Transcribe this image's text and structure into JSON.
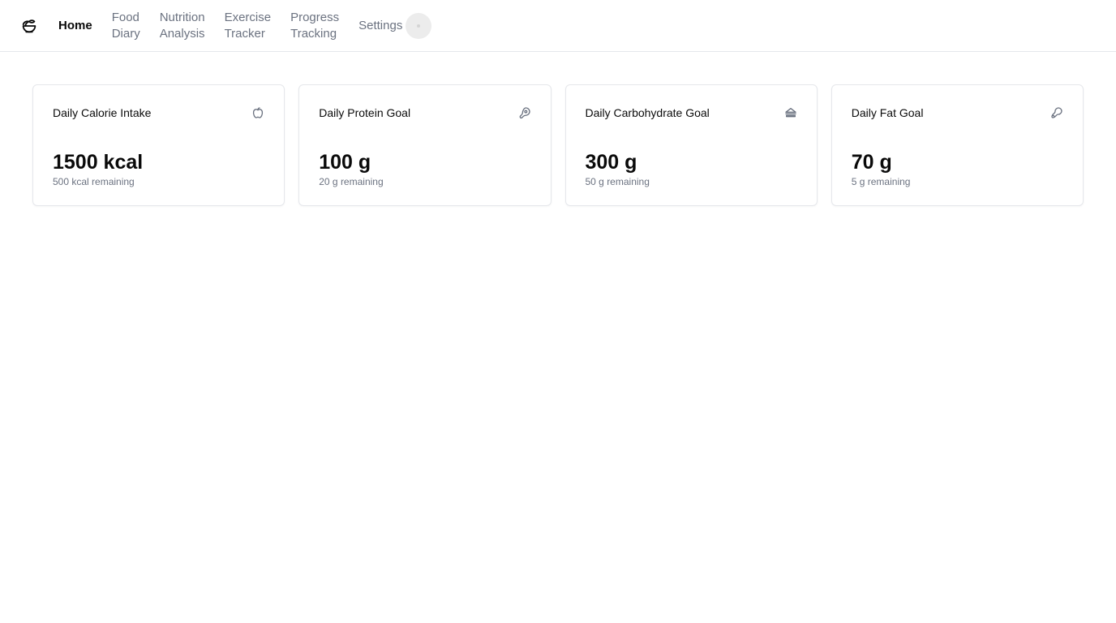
{
  "nav": {
    "items": [
      {
        "label": "Home"
      },
      {
        "label": "Food\nDiary"
      },
      {
        "label": "Nutrition\nAnalysis"
      },
      {
        "label": "Exercise\nTracker"
      },
      {
        "label": "Progress\nTracking"
      },
      {
        "label": "Settings"
      }
    ]
  },
  "cards": [
    {
      "title": "Daily Calorie Intake",
      "value": "1500 kcal",
      "sub": "500 kcal remaining",
      "icon": "apple-icon"
    },
    {
      "title": "Daily Protein Goal",
      "value": "100 g",
      "sub": "20 g remaining",
      "icon": "meat-icon"
    },
    {
      "title": "Daily Carbohydrate Goal",
      "value": "300 g",
      "sub": "50 g remaining",
      "icon": "sandwich-icon"
    },
    {
      "title": "Daily Fat Goal",
      "value": "70 g",
      "sub": "5 g remaining",
      "icon": "drumstick-icon"
    }
  ],
  "colors": {
    "text": "#0a0a0a",
    "muted": "#6b7280",
    "border": "#e5e7eb"
  }
}
